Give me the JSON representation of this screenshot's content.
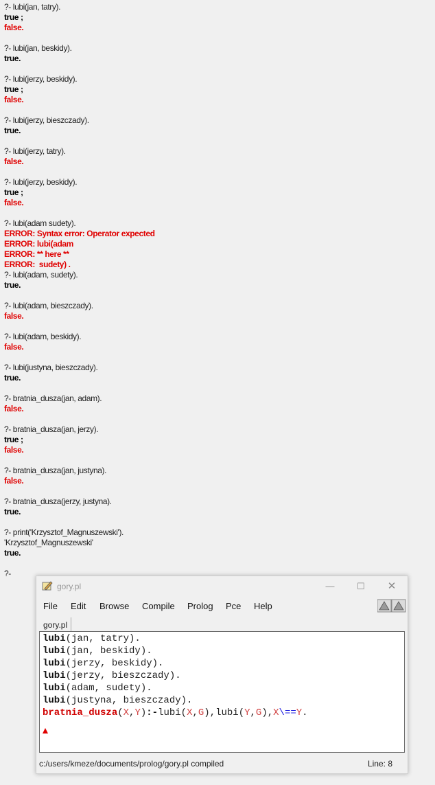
{
  "console": {
    "lines": [
      {
        "kind": "query",
        "text": "?- lubi(jan, tatry)."
      },
      {
        "kind": "res",
        "text": "true ;"
      },
      {
        "kind": "neg",
        "text": "false."
      },
      {
        "kind": "blank",
        "text": ""
      },
      {
        "kind": "query",
        "text": "?- lubi(jan, beskidy)."
      },
      {
        "kind": "res",
        "text": "true."
      },
      {
        "kind": "blank",
        "text": ""
      },
      {
        "kind": "query",
        "text": "?- lubi(jerzy, beskidy)."
      },
      {
        "kind": "res",
        "text": "true ;"
      },
      {
        "kind": "neg",
        "text": "false."
      },
      {
        "kind": "blank",
        "text": ""
      },
      {
        "kind": "query",
        "text": "?- lubi(jerzy, bieszczady)."
      },
      {
        "kind": "res",
        "text": "true."
      },
      {
        "kind": "blank",
        "text": ""
      },
      {
        "kind": "query",
        "text": "?- lubi(jerzy, tatry)."
      },
      {
        "kind": "neg",
        "text": "false."
      },
      {
        "kind": "blank",
        "text": ""
      },
      {
        "kind": "query",
        "text": "?- lubi(jerzy, beskidy)."
      },
      {
        "kind": "res",
        "text": "true ;"
      },
      {
        "kind": "neg",
        "text": "false."
      },
      {
        "kind": "blank",
        "text": ""
      },
      {
        "kind": "query",
        "text": "?- lubi(adam sudety)."
      },
      {
        "kind": "err",
        "text": "ERROR: Syntax error: Operator expected"
      },
      {
        "kind": "err",
        "text": "ERROR: lubi(adam"
      },
      {
        "kind": "err",
        "text": "ERROR: ** here **"
      },
      {
        "kind": "err",
        "text": "ERROR:  sudety) ."
      },
      {
        "kind": "query",
        "text": "?- lubi(adam, sudety)."
      },
      {
        "kind": "res",
        "text": "true."
      },
      {
        "kind": "blank",
        "text": ""
      },
      {
        "kind": "query",
        "text": "?- lubi(adam, bieszczady)."
      },
      {
        "kind": "neg",
        "text": "false."
      },
      {
        "kind": "blank",
        "text": ""
      },
      {
        "kind": "query",
        "text": "?- lubi(adam, beskidy)."
      },
      {
        "kind": "neg",
        "text": "false."
      },
      {
        "kind": "blank",
        "text": ""
      },
      {
        "kind": "query",
        "text": "?- lubi(justyna, bieszczady)."
      },
      {
        "kind": "res",
        "text": "true."
      },
      {
        "kind": "blank",
        "text": ""
      },
      {
        "kind": "query",
        "text": "?- bratnia_dusza(jan, adam)."
      },
      {
        "kind": "neg",
        "text": "false."
      },
      {
        "kind": "blank",
        "text": ""
      },
      {
        "kind": "query",
        "text": "?- bratnia_dusza(jan, jerzy)."
      },
      {
        "kind": "res",
        "text": "true ;"
      },
      {
        "kind": "neg",
        "text": "false."
      },
      {
        "kind": "blank",
        "text": ""
      },
      {
        "kind": "query",
        "text": "?- bratnia_dusza(jan, justyna)."
      },
      {
        "kind": "neg",
        "text": "false."
      },
      {
        "kind": "blank",
        "text": ""
      },
      {
        "kind": "query",
        "text": "?- bratnia_dusza(jerzy, justyna)."
      },
      {
        "kind": "res",
        "text": "true."
      },
      {
        "kind": "blank",
        "text": ""
      },
      {
        "kind": "query",
        "text": "?- print('Krzysztof_Magnuszewski')."
      },
      {
        "kind": "out",
        "text": "'Krzysztof_Magnuszewski'"
      },
      {
        "kind": "res",
        "text": "true."
      },
      {
        "kind": "blank",
        "text": ""
      },
      {
        "kind": "query",
        "text": "?-"
      }
    ]
  },
  "editor": {
    "title": "gory.pl",
    "menu": [
      "File",
      "Edit",
      "Browse",
      "Compile",
      "Prolog",
      "Pce",
      "Help"
    ],
    "tab": "gory.pl",
    "facts": [
      {
        "name": "lubi",
        "args": "(jan, tatry)."
      },
      {
        "name": "lubi",
        "args": "(jan, beskidy)."
      },
      {
        "name": "lubi",
        "args": "(jerzy, beskidy)."
      },
      {
        "name": "lubi",
        "args": "(jerzy, bieszczady)."
      },
      {
        "name": "lubi",
        "args": "(adam, sudety)."
      },
      {
        "name": "lubi",
        "args": "(justyna, bieszczady)."
      }
    ],
    "rule": {
      "head": "bratnia_dusza",
      "p1": "(",
      "v1": "X",
      "c1": ",",
      "v2": "Y",
      "p2": ")",
      "neck": ":-",
      "b1": "lubi(",
      "v3": "X",
      "c2": ",",
      "v4": "G",
      "b2": "),lubi(",
      "v5": "Y",
      "c3": ",",
      "v6": "G",
      "b3": "),",
      "v7": "X",
      "op": "\\==",
      "v8": "Y",
      "end": "."
    },
    "status": "c:/users/kmeze/documents/prolog/gory.pl compiled",
    "line_indicator": "Line: 8"
  }
}
